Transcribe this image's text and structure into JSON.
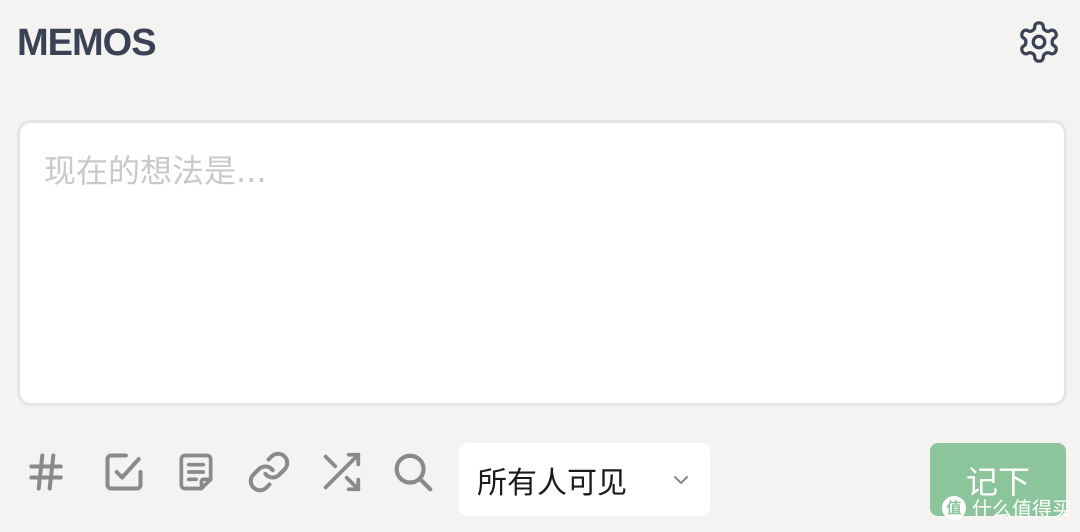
{
  "header": {
    "title": "MEMOS",
    "settings_icon": "gear-icon"
  },
  "editor": {
    "placeholder": "现在的想法是...",
    "value": ""
  },
  "toolbar": {
    "icons": [
      "hash-icon",
      "checkbox-icon",
      "document-icon",
      "link-icon",
      "shuffle-icon",
      "search-icon"
    ],
    "visibility": {
      "selected": "所有人可见",
      "icon": "chevron-down-icon"
    },
    "submit_label": "记下"
  },
  "watermark": {
    "logo": "值",
    "text": "什么值得买"
  },
  "colors": {
    "background": "#f4f3f1",
    "title": "#3b4255",
    "submit": "#8cc59b",
    "icon": "#8a8a8a"
  }
}
